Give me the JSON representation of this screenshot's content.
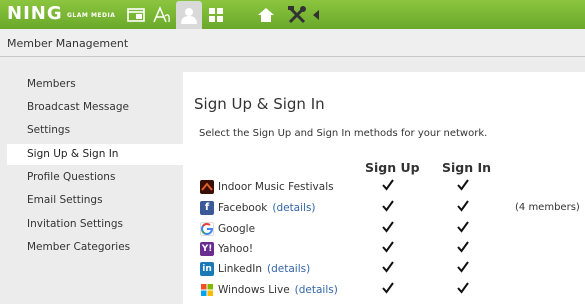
{
  "topbar": {
    "logo": "NING",
    "logo_sub": "GLAM MEDIA",
    "icons": [
      "window-icon",
      "text-style-icon",
      "person-icon",
      "grid-icon",
      "home-icon",
      "tools-icon",
      "collapse-arrow-icon"
    ],
    "brand_color": "#7ab833"
  },
  "header": {
    "title": "Member Management"
  },
  "sidebar": {
    "items": [
      {
        "label": "Members"
      },
      {
        "label": "Broadcast Message"
      },
      {
        "label": "Settings"
      },
      {
        "label": "Sign Up & Sign In",
        "active": true
      },
      {
        "label": "Profile Questions"
      },
      {
        "label": "Email Settings"
      },
      {
        "label": "Invitation Settings"
      },
      {
        "label": "Member Categories"
      }
    ]
  },
  "main": {
    "title": "Sign Up & Sign In",
    "description": "Select the Sign Up and Sign In methods for your network.",
    "col_signup": "Sign Up",
    "col_signin": "Sign In",
    "providers": [
      {
        "name": "Indoor Music Festivals",
        "details": "",
        "members": "",
        "icon": "network-icon",
        "color": "#7a2a1a",
        "signup": true,
        "signin": true
      },
      {
        "name": "Facebook",
        "details": "(details)",
        "members": "(4 members)",
        "icon": "facebook-icon",
        "color": "#3b5998",
        "signup": true,
        "signin": true
      },
      {
        "name": "Google",
        "details": "",
        "members": "",
        "icon": "google-icon",
        "color": "#ffffff",
        "signup": true,
        "signin": true
      },
      {
        "name": "Yahoo!",
        "details": "",
        "members": "",
        "icon": "yahoo-icon",
        "color": "#6a2c91",
        "signup": true,
        "signin": true
      },
      {
        "name": "LinkedIn",
        "details": "(details)",
        "members": "",
        "icon": "linkedin-icon",
        "color": "#1a7ab8",
        "signup": true,
        "signin": true
      },
      {
        "name": "Windows Live",
        "details": "(details)",
        "members": "",
        "icon": "windows-live-icon",
        "color": "#ffffff",
        "signup": true,
        "signin": true
      }
    ]
  }
}
